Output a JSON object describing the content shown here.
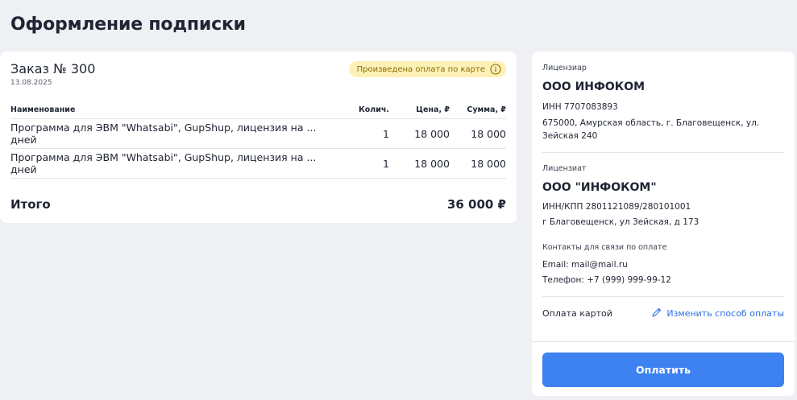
{
  "page": {
    "title": "Оформление подписки"
  },
  "order": {
    "title": "Заказ № 300",
    "date": "13.08.2025",
    "badge": "Произведена оплата по карте",
    "columns": {
      "name": "Наименование",
      "qty": "Колич.",
      "price": "Цена, ₽",
      "sum": "Сумма, ₽"
    },
    "items": [
      {
        "name": "Программа для ЭВМ \"Whatsabi\", GupShup, лицензия на ... дней",
        "qty": "1",
        "price": "18 000",
        "sum": "18 000"
      },
      {
        "name": "Программа для ЭВМ \"Whatsabi\", GupShup, лицензия на ... дней",
        "qty": "1",
        "price": "18 000",
        "sum": "18 000"
      }
    ],
    "total_label": "Итого",
    "total_value": "36 000 ₽"
  },
  "licensor": {
    "label": "Лицензиар",
    "name": "ООО ИНФОКОМ",
    "inn": "ИНН 7707083893",
    "address": "675000, Амурская область, г. Благовещенск, ул. Зейская 240"
  },
  "licensee": {
    "label": "Лицензиат",
    "name": "ООО \"ИНФОКОМ\"",
    "inn": "ИНН/КПП 2801121089/280101001",
    "address": "г Благовещенск, ул Зейская, д 173"
  },
  "contacts": {
    "label": "Контакты для связи по оплате",
    "email": "Email: mail@mail.ru",
    "phone": "Телефон: +7 (999) 999-99-12"
  },
  "payment": {
    "method": "Оплата картой",
    "change_label": "Изменить способ оплаты",
    "pay_button": "Оплатить"
  },
  "colors": {
    "accent": "#3d82f0",
    "link": "#2f6fe0",
    "badge_bg": "#fdf1b8",
    "badge_text": "#8a6d00",
    "background": "#eef0f4"
  },
  "icons": {
    "badge": "info-icon",
    "change": "pencil-icon"
  }
}
